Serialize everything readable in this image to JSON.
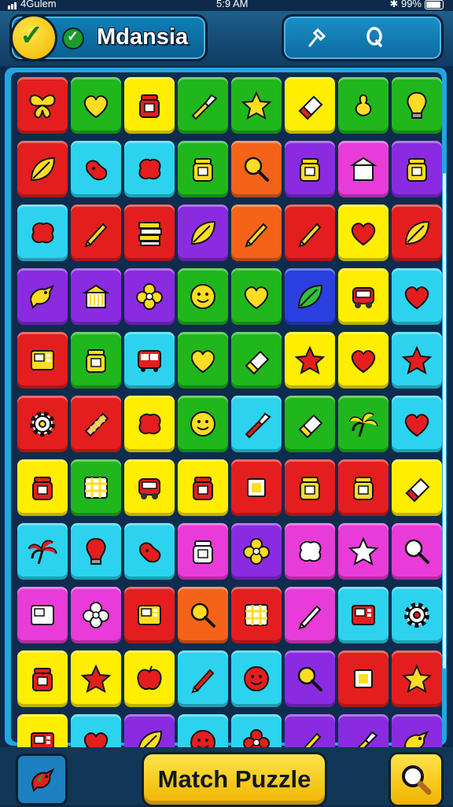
{
  "status_bar": {
    "carrier": "4Gulem",
    "time": "5:9 AM",
    "battery": "99%"
  },
  "header": {
    "title": "Mdansia",
    "tools": [
      "pin-icon",
      "search-q-icon"
    ]
  },
  "board": {
    "rows": [
      [
        [
          "red",
          "butterfly"
        ],
        [
          "green",
          "heart"
        ],
        [
          "yellow",
          "jar"
        ],
        [
          "green",
          "brush"
        ],
        [
          "green",
          "star"
        ],
        [
          "yellow",
          "eraser"
        ],
        [
          "green",
          "pear"
        ],
        [
          "green",
          "bulb"
        ]
      ],
      [
        [
          "red",
          "leaf"
        ],
        [
          "cyan",
          "bean"
        ],
        [
          "cyan",
          "blob"
        ],
        [
          "green",
          "jar"
        ],
        [
          "orange",
          "magnifier"
        ],
        [
          "purple",
          "jar"
        ],
        [
          "magenta",
          "house"
        ],
        [
          "purple",
          "jar"
        ]
      ],
      [
        [
          "cyan",
          "blob"
        ],
        [
          "red",
          "pencil"
        ],
        [
          "red",
          "books"
        ],
        [
          "purple",
          "leaf"
        ],
        [
          "orange",
          "pencil"
        ],
        [
          "red",
          "pencil"
        ],
        [
          "yellow",
          "heart"
        ],
        [
          "red",
          "leaf"
        ]
      ],
      [
        [
          "purple",
          "bird"
        ],
        [
          "purple",
          "house"
        ],
        [
          "purple",
          "flower"
        ],
        [
          "green",
          "face"
        ],
        [
          "green",
          "heart"
        ],
        [
          "navy",
          "leaf"
        ],
        [
          "yellow",
          "robot"
        ],
        [
          "cyan",
          "heart"
        ]
      ],
      [
        [
          "red",
          "screen"
        ],
        [
          "green",
          "jar"
        ],
        [
          "cyan",
          "bus"
        ],
        [
          "green",
          "heart"
        ],
        [
          "green",
          "eraser"
        ],
        [
          "yellow",
          "star"
        ],
        [
          "yellow",
          "heart"
        ],
        [
          "cyan",
          "star"
        ]
      ],
      [
        [
          "red",
          "gear"
        ],
        [
          "red",
          "bat"
        ],
        [
          "yellow",
          "blob"
        ],
        [
          "green",
          "face"
        ],
        [
          "cyan",
          "brush"
        ],
        [
          "green",
          "eraser"
        ],
        [
          "green",
          "palm"
        ],
        [
          "cyan",
          "heart"
        ]
      ],
      [
        [
          "yellow",
          "jar"
        ],
        [
          "green",
          "grid"
        ],
        [
          "yellow",
          "robot"
        ],
        [
          "yellow",
          "jar"
        ],
        [
          "red",
          "square"
        ],
        [
          "red",
          "jar"
        ],
        [
          "red",
          "jar"
        ],
        [
          "yellow",
          "eraser"
        ]
      ],
      [
        [
          "cyan",
          "palm"
        ],
        [
          "cyan",
          "bulb"
        ],
        [
          "cyan",
          "bean"
        ],
        [
          "magenta",
          "jar"
        ],
        [
          "purple",
          "flower"
        ],
        [
          "magenta",
          "blob"
        ],
        [
          "magenta",
          "star"
        ],
        [
          "magenta",
          "magnifier"
        ]
      ],
      [
        [
          "magenta",
          "screen"
        ],
        [
          "magenta",
          "flower"
        ],
        [
          "red",
          "screen"
        ],
        [
          "orange",
          "magnifier"
        ],
        [
          "red",
          "grid"
        ],
        [
          "magenta",
          "pencil"
        ],
        [
          "cyan",
          "screen"
        ],
        [
          "cyan",
          "gear"
        ]
      ],
      [
        [
          "yellow",
          "jar"
        ],
        [
          "yellow",
          "star"
        ],
        [
          "yellow",
          "apple"
        ],
        [
          "cyan",
          "pencil"
        ],
        [
          "cyan",
          "face"
        ],
        [
          "purple",
          "magnifier"
        ],
        [
          "red",
          "square"
        ],
        [
          "red",
          "star"
        ]
      ],
      [
        [
          "yellow",
          "screen"
        ],
        [
          "cyan",
          "heart"
        ],
        [
          "purple",
          "leaf"
        ],
        [
          "cyan",
          "face"
        ],
        [
          "cyan",
          "flower"
        ],
        [
          "purple",
          "pencil"
        ],
        [
          "purple",
          "brush"
        ],
        [
          "purple",
          "bird"
        ]
      ]
    ]
  },
  "footer": {
    "left_icon": "bird-icon",
    "match_label": "Match Puzzle",
    "right_icon": "magnifier-icon"
  },
  "palette": {
    "red": "#e41e1e",
    "green": "#1fb71c",
    "yellow": "#ffee00",
    "cyan": "#2cd3ee",
    "orange": "#f5621a",
    "purple": "#8a2be2",
    "magenta": "#e93bd8",
    "navy": "#2a3fe0"
  }
}
